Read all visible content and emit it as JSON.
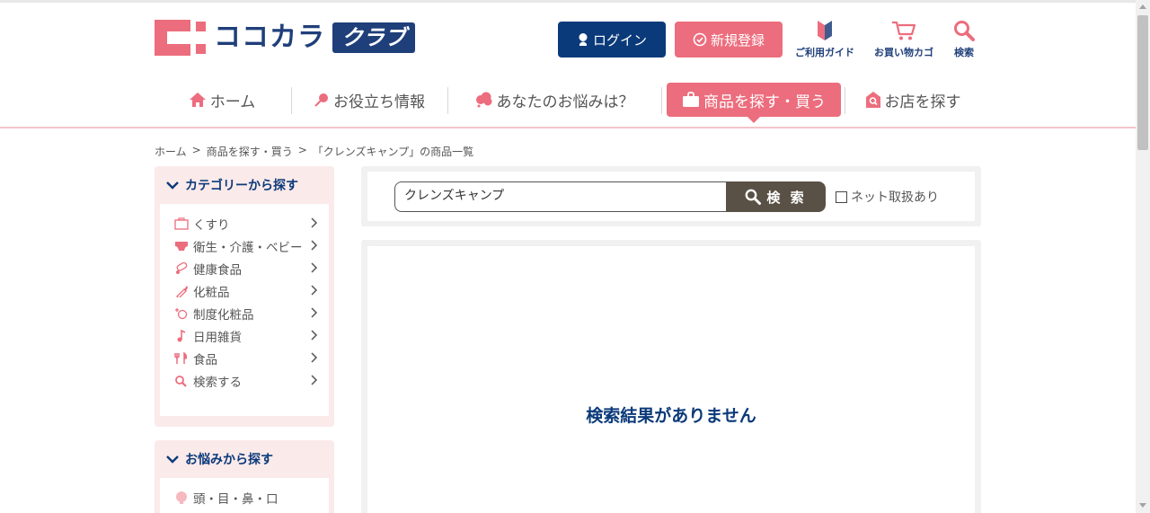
{
  "header": {
    "logo_text": "ココカラ",
    "logo_club": "クラブ",
    "login_label": "ログイン",
    "register_label": "新規登録",
    "guide_label": "ご利用ガイド",
    "cart_label": "お買い物カゴ",
    "search_label": "検索"
  },
  "nav": {
    "items": [
      {
        "label": "ホーム",
        "icon": "home-icon"
      },
      {
        "label": "お役立ち情報",
        "icon": "pin-icon"
      },
      {
        "label": "あなたのお悩みは？",
        "icon": "cloud-icon"
      },
      {
        "label": "商品を探す・買う",
        "icon": "bag-icon",
        "active": true
      },
      {
        "label": "お店を探す",
        "icon": "store-icon"
      }
    ]
  },
  "breadcrumb": {
    "items": [
      "ホーム",
      "商品を探す・買う",
      "「クレンズキャンプ」の商品一覧"
    ],
    "separator": ">"
  },
  "sidebar": {
    "category_title": "カテゴリーから探す",
    "categories": [
      {
        "label": "くすり",
        "icon": "medicine-icon"
      },
      {
        "label": "衛生・介護・ベビー",
        "icon": "diaper-icon"
      },
      {
        "label": "健康食品",
        "icon": "supplement-icon"
      },
      {
        "label": "化粧品",
        "icon": "lipstick-icon"
      },
      {
        "label": "制度化粧品",
        "icon": "sparkle-icon"
      },
      {
        "label": "日用雑貨",
        "icon": "note-icon"
      },
      {
        "label": "食品",
        "icon": "fork-icon"
      },
      {
        "label": "検索する",
        "icon": "search-icon"
      }
    ],
    "concern_title": "お悩みから探す",
    "concerns": [
      {
        "label": "頭・目・鼻・口",
        "icon": "head-icon"
      }
    ]
  },
  "search": {
    "value": "クレンズキャンプ",
    "button_label": "検 索",
    "net_label": "ネット取扱あり",
    "net_checked": false
  },
  "results": {
    "empty_message": "検索結果がありません"
  },
  "colors": {
    "brand_pink": "#ec6d7d",
    "brand_navy": "#0b3a7a",
    "search_button": "#5a5146"
  }
}
